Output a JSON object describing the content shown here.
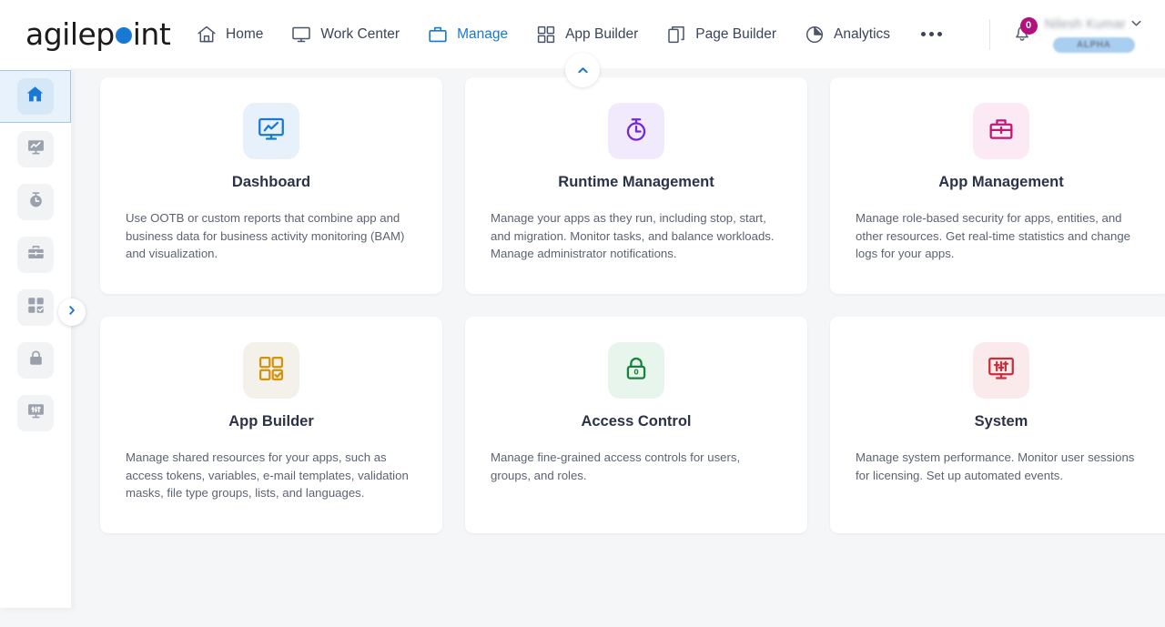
{
  "header": {
    "brand": {
      "before": "agilep",
      "after": "int",
      "dot": "brand-dot"
    },
    "nav": [
      {
        "label": "Home",
        "icon": "home-icon",
        "active": false
      },
      {
        "label": "Work Center",
        "icon": "monitor-icon",
        "active": false
      },
      {
        "label": "Manage",
        "icon": "briefcase-icon",
        "active": true
      },
      {
        "label": "App Builder",
        "icon": "grid-icon",
        "active": false
      },
      {
        "label": "Page Builder",
        "icon": "pages-icon",
        "active": false
      },
      {
        "label": "Analytics",
        "icon": "pie-chart-icon",
        "active": false
      }
    ],
    "more_label": "More options",
    "notifications": {
      "count": "0",
      "icon": "bell-icon"
    },
    "user": {
      "name": "Nilesh Kumar",
      "caret": "⌄",
      "badge": "ALPHA"
    },
    "collapse_button": "chevron-up-icon"
  },
  "sidebar": {
    "expand_button": "chevron-right-icon",
    "items": [
      {
        "name": "home",
        "icon": "home-icon",
        "active": true
      },
      {
        "name": "dashboard",
        "icon": "dashboard-icon",
        "active": false
      },
      {
        "name": "runtime-management",
        "icon": "stopwatch-icon",
        "active": false
      },
      {
        "name": "app-management",
        "icon": "briefcase-icon",
        "active": false
      },
      {
        "name": "app-builder",
        "icon": "grid-check-icon",
        "active": false
      },
      {
        "name": "access-control",
        "icon": "lock-icon",
        "active": false
      },
      {
        "name": "system",
        "icon": "sliders-monitor-icon",
        "active": false
      }
    ]
  },
  "main": {
    "cards": [
      {
        "key": "dashboard",
        "title": "Dashboard",
        "desc": "Use OOTB or custom reports that combine app and business data for business activity monitoring (BAM) and visualization.",
        "icon": "dashboard-icon",
        "icon_color": "#1878d4",
        "icon_bg": "#e7f1fb"
      },
      {
        "key": "runtime-management",
        "title": "Runtime Management",
        "desc": "Manage your apps as they run, including stop, start, and migration. Monitor tasks, and balance workloads. Manage administrator notifications.",
        "icon": "stopwatch-icon",
        "icon_color": "#7327d6",
        "icon_bg": "#f1eafc"
      },
      {
        "key": "app-management",
        "title": "App Management",
        "desc": "Manage role-based security for apps, entities, and other resources. Get real-time statistics and change logs for your apps.",
        "icon": "briefcase-icon",
        "icon_color": "#bf1776",
        "icon_bg": "#fbeaf4"
      },
      {
        "key": "app-builder",
        "title": "App Builder",
        "desc": "Manage shared resources for your apps, such as access tokens, variables, e-mail templates, validation masks, file type groups, lists, and languages.",
        "icon": "grid-check-icon",
        "icon_color": "#d1920c",
        "icon_bg": "#f4f1ea"
      },
      {
        "key": "access-control",
        "title": "Access Control",
        "desc": "Manage fine-grained access controls for users, groups, and roles.",
        "icon": "lock-icon",
        "icon_color": "#17823c",
        "icon_bg": "#e8f5ec"
      },
      {
        "key": "system",
        "title": "System",
        "desc": "Manage system performance. Monitor user sessions for licensing. Set up automated events.",
        "icon": "sliders-monitor-icon",
        "icon_color": "#c5303a",
        "icon_bg": "#fbeaec"
      }
    ]
  },
  "colors": {
    "accent": "#1878d4",
    "page_bg": "#f5f6f8",
    "badge": "#b3127c"
  }
}
